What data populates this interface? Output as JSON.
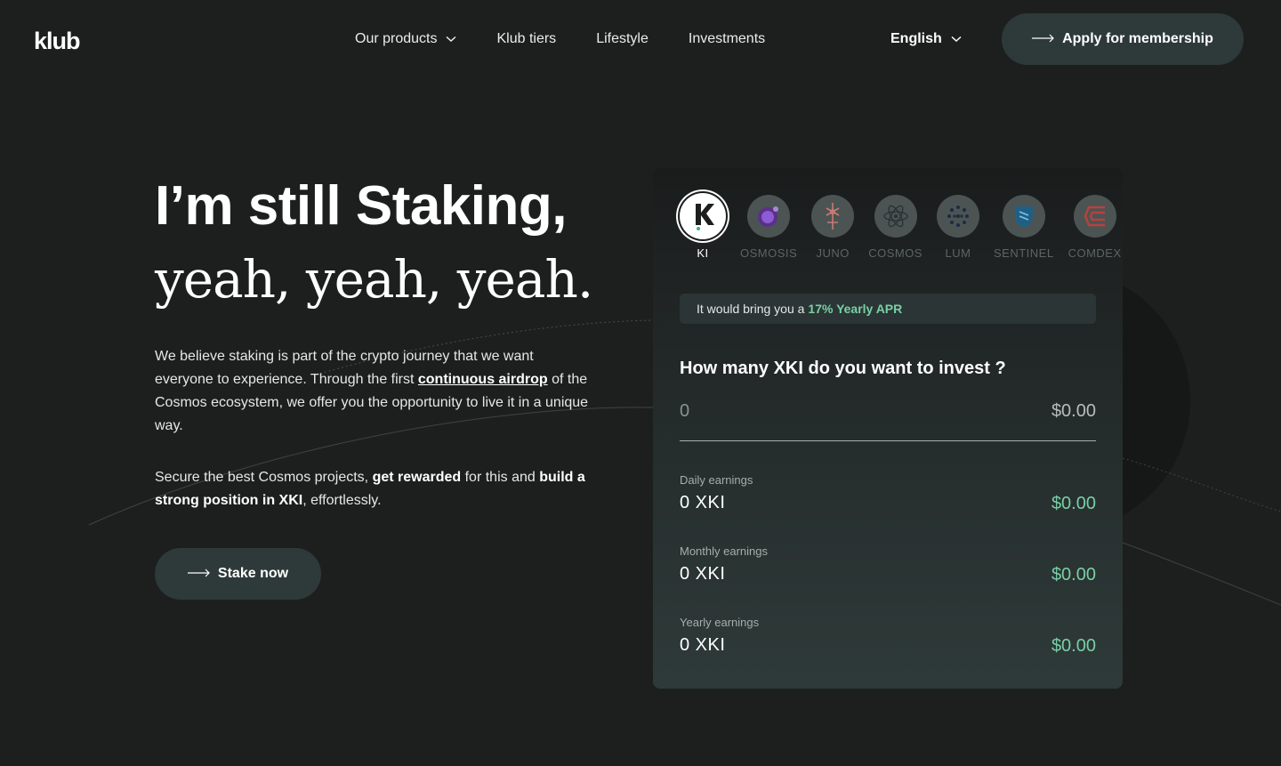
{
  "header": {
    "logo": "klub",
    "nav": [
      {
        "label": "Our products",
        "has_dropdown": true
      },
      {
        "label": "Klub tiers"
      },
      {
        "label": "Lifestyle"
      },
      {
        "label": "Investments"
      }
    ],
    "language": "English",
    "apply_label": "Apply for membership"
  },
  "hero": {
    "title_line1": "I’m still Staking,",
    "title_line2": "yeah, yeah, yeah.",
    "para1_before": "We believe staking is part of the crypto journey that we want everyone to experience. Through the first ",
    "para1_link": "continuous airdrop",
    "para1_after": " of the Cosmos ecosystem, we offer you the opportunity to live it in a unique way.",
    "para2_a": "Secure the best Cosmos projects, ",
    "para2_b": "get rewarded",
    "para2_c": " for this and ",
    "para2_d": "build a strong position in XKI",
    "para2_e": ", effortlessly.",
    "cta_label": "Stake now"
  },
  "calculator": {
    "tokens": [
      {
        "label": "KI",
        "active": true
      },
      {
        "label": "OSMOSIS"
      },
      {
        "label": "JUNO"
      },
      {
        "label": "COSMOS"
      },
      {
        "label": "LUM"
      },
      {
        "label": "SENTINEL"
      },
      {
        "label": "COMDEX"
      }
    ],
    "apr_prefix": "It would bring you a",
    "apr_value": "17% Yearly APR",
    "question": "How many XKI do you want to invest ?",
    "amount_placeholder": "0",
    "amount_usd": "$0.00",
    "earnings": [
      {
        "label": "Daily earnings",
        "value": "0 XKI",
        "usd": "$0.00"
      },
      {
        "label": "Monthly earnings",
        "value": "0 XKI",
        "usd": "$0.00"
      },
      {
        "label": "Yearly earnings",
        "value": "0 XKI",
        "usd": "$0.00"
      }
    ]
  },
  "colors": {
    "background": "#1d1f1f",
    "button": "#2e3939",
    "accent_green": "#79cfa6"
  }
}
